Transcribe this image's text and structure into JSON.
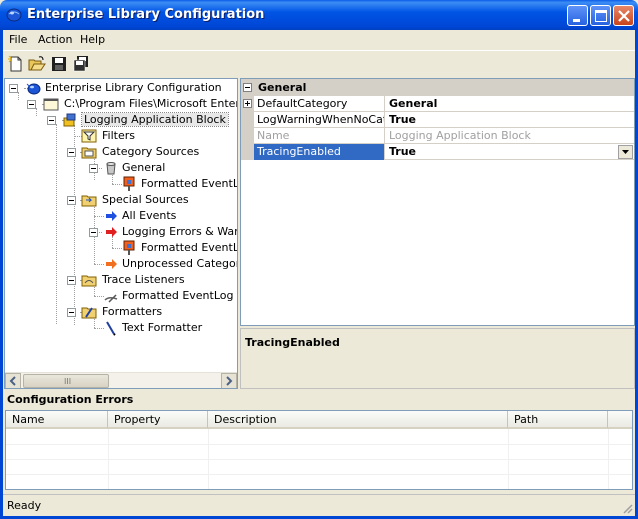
{
  "window": {
    "title": "Enterprise Library Configuration"
  },
  "menu": {
    "file": "File",
    "action": "Action",
    "help": "Help"
  },
  "toolbar": {
    "icons": [
      "new-icon",
      "open-icon",
      "save-icon",
      "save-all-icon"
    ]
  },
  "tree": {
    "nodes": [
      {
        "label": "Enterprise Library Configuration",
        "icon": "globe-icon"
      },
      {
        "label": "C:\\Program Files\\Microsoft Enterprise Library",
        "icon": "window-icon"
      },
      {
        "label": "Logging Application Block",
        "icon": "block-icon"
      },
      {
        "label": "Filters",
        "icon": "filter-icon"
      },
      {
        "label": "Category Sources",
        "icon": "folder-icon"
      },
      {
        "label": "General",
        "icon": "bucket-icon"
      },
      {
        "label": "Formatted EventLog TraceListener",
        "icon": "listener-icon"
      },
      {
        "label": "Special Sources",
        "icon": "folder-icon"
      },
      {
        "label": "All Events",
        "icon": "blue-arrow-icon"
      },
      {
        "label": "Logging Errors & Warnings",
        "icon": "red-arrow-icon"
      },
      {
        "label": "Formatted EventLog TraceListener",
        "icon": "listener-icon"
      },
      {
        "label": "Unprocessed Category",
        "icon": "orange-arrow-icon"
      },
      {
        "label": "Trace Listeners",
        "icon": "folder-icon"
      },
      {
        "label": "Formatted EventLog TraceListener",
        "icon": "pen-icon"
      },
      {
        "label": "Formatters",
        "icon": "folder-icon"
      },
      {
        "label": "Text Formatter",
        "icon": "pencil-icon"
      }
    ]
  },
  "properties": {
    "category": "General",
    "rows": [
      {
        "name": "DefaultCategory",
        "value": "General"
      },
      {
        "name": "LogWarningWhenNoCategoriesMatch",
        "value": "True"
      },
      {
        "name": "Name",
        "value": "Logging Application Block"
      },
      {
        "name": "TracingEnabled",
        "value": "True"
      }
    ]
  },
  "description": {
    "title": "TracingEnabled"
  },
  "errors": {
    "title": "Configuration Errors",
    "columns": [
      "Name",
      "Property",
      "Description",
      "Path"
    ]
  },
  "status": {
    "text": "Ready"
  },
  "scrollbar": {
    "grip": "III"
  }
}
